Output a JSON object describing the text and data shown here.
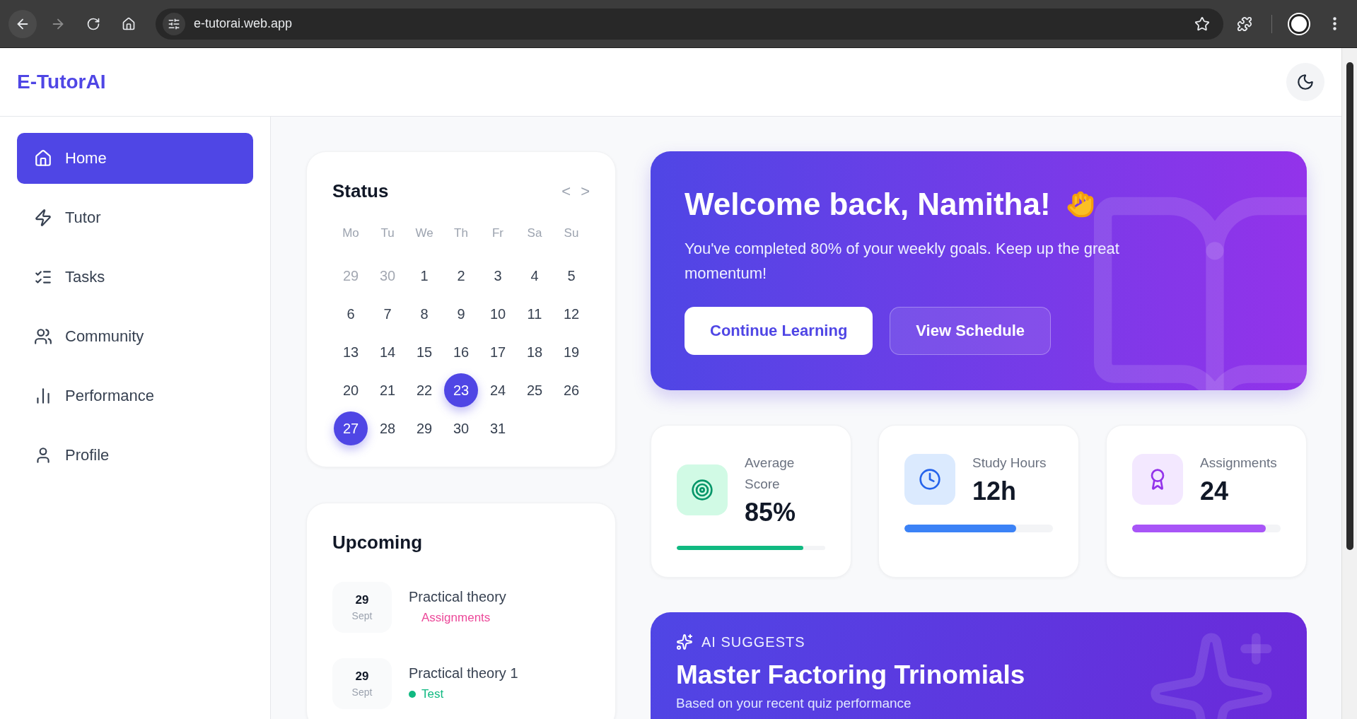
{
  "browser": {
    "url": "e-tutorai.web.app"
  },
  "app": {
    "logo": "E-TutorAI"
  },
  "sidebar": {
    "items": [
      {
        "label": "Home",
        "selected": true
      },
      {
        "label": "Tutor",
        "selected": false
      },
      {
        "label": "Tasks",
        "selected": false
      },
      {
        "label": "Community",
        "selected": false
      },
      {
        "label": "Performance",
        "selected": false
      },
      {
        "label": "Profile",
        "selected": false
      }
    ]
  },
  "calendar": {
    "title": "Status",
    "prev": "<",
    "next": ">",
    "weekdays": [
      "Mo",
      "Tu",
      "We",
      "Th",
      "Fr",
      "Sa",
      "Su"
    ],
    "days": [
      {
        "label": "29",
        "muted": true,
        "selected": false
      },
      {
        "label": "30",
        "muted": true,
        "selected": false
      },
      {
        "label": "1",
        "muted": false,
        "selected": false
      },
      {
        "label": "2",
        "muted": false,
        "selected": false
      },
      {
        "label": "3",
        "muted": false,
        "selected": false
      },
      {
        "label": "4",
        "muted": false,
        "selected": false
      },
      {
        "label": "5",
        "muted": false,
        "selected": false
      },
      {
        "label": "6",
        "muted": false,
        "selected": false
      },
      {
        "label": "7",
        "muted": false,
        "selected": false
      },
      {
        "label": "8",
        "muted": false,
        "selected": false
      },
      {
        "label": "9",
        "muted": false,
        "selected": false
      },
      {
        "label": "10",
        "muted": false,
        "selected": false
      },
      {
        "label": "11",
        "muted": false,
        "selected": false
      },
      {
        "label": "12",
        "muted": false,
        "selected": false
      },
      {
        "label": "13",
        "muted": false,
        "selected": false
      },
      {
        "label": "14",
        "muted": false,
        "selected": false
      },
      {
        "label": "15",
        "muted": false,
        "selected": false
      },
      {
        "label": "16",
        "muted": false,
        "selected": false
      },
      {
        "label": "17",
        "muted": false,
        "selected": false
      },
      {
        "label": "18",
        "muted": false,
        "selected": false
      },
      {
        "label": "19",
        "muted": false,
        "selected": false
      },
      {
        "label": "20",
        "muted": false,
        "selected": false
      },
      {
        "label": "21",
        "muted": false,
        "selected": false
      },
      {
        "label": "22",
        "muted": false,
        "selected": false
      },
      {
        "label": "23",
        "muted": false,
        "selected": true
      },
      {
        "label": "24",
        "muted": false,
        "selected": false
      },
      {
        "label": "25",
        "muted": false,
        "selected": false
      },
      {
        "label": "26",
        "muted": false,
        "selected": false
      },
      {
        "label": "27",
        "muted": false,
        "selected": true
      },
      {
        "label": "28",
        "muted": false,
        "selected": false
      },
      {
        "label": "29",
        "muted": false,
        "selected": false
      },
      {
        "label": "30",
        "muted": false,
        "selected": false
      },
      {
        "label": "31",
        "muted": false,
        "selected": false
      }
    ]
  },
  "upcoming": {
    "title": "Upcoming",
    "items": [
      {
        "day": "29",
        "month": "Sept",
        "title": "Practical theory",
        "tag": "Assignments",
        "color": "#ec4899",
        "dot": false
      },
      {
        "day": "29",
        "month": "Sept",
        "title": "Practical theory 1",
        "tag": "Test",
        "color": "#10b981",
        "dot": true
      }
    ]
  },
  "hero": {
    "title": "Welcome back, Namitha!",
    "text": "You've completed 80% of your weekly goals. Keep up the great momentum!",
    "buttons": [
      {
        "label": "Continue Learning",
        "kind": "primary"
      },
      {
        "label": "View Schedule",
        "kind": "secondary"
      }
    ]
  },
  "stats": [
    {
      "label": "Average Score",
      "value": "85%",
      "level": 0.85,
      "color": "#10b981"
    },
    {
      "label": "Study Hours",
      "value": "12h",
      "level": 0.75,
      "color": "#3b82f6"
    },
    {
      "label": "Assignments",
      "value": "24",
      "level": 0.9,
      "color": "#a855f7"
    }
  ],
  "suggestion": {
    "eyebrow": "AI SUGGESTS",
    "title": "Master Factoring Trinomials",
    "text": "Based on your recent quiz performance"
  }
}
